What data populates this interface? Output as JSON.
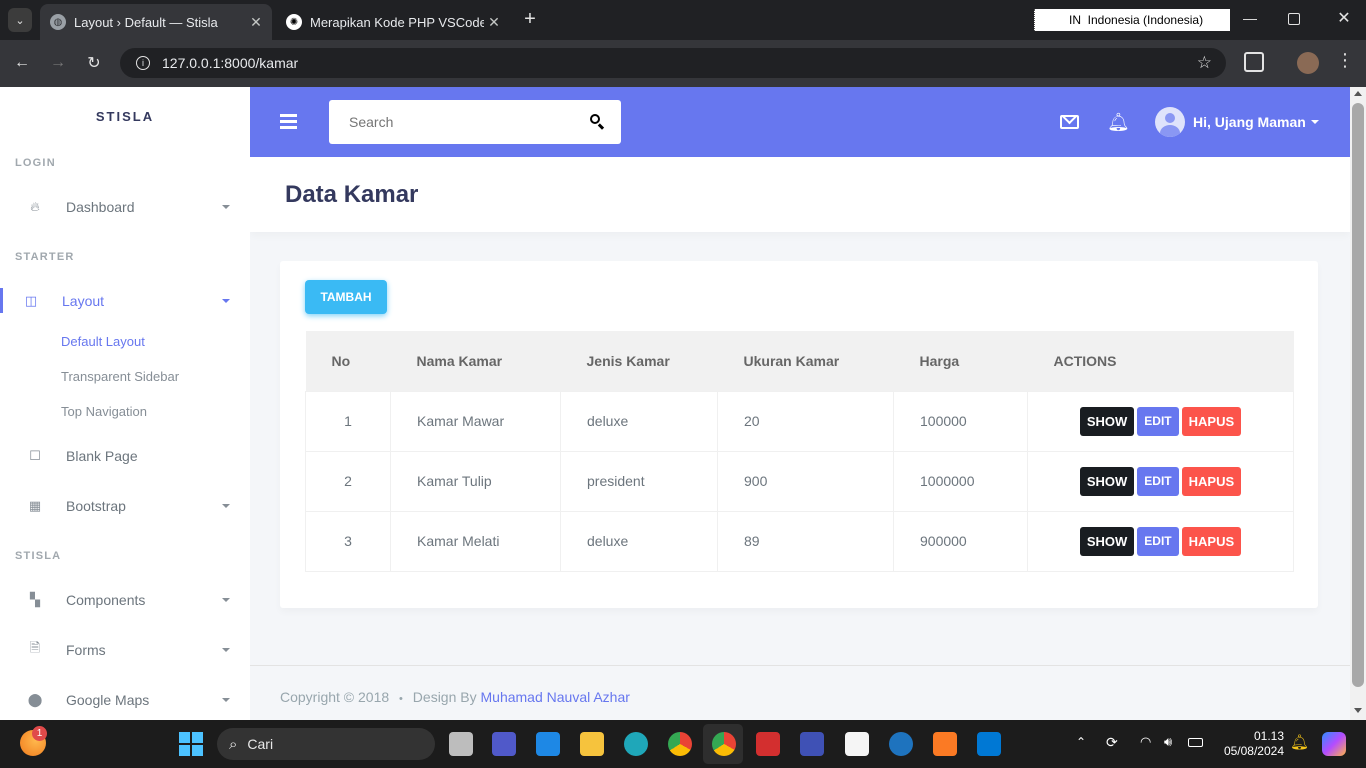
{
  "browser": {
    "tabs": [
      {
        "title": "Layout › Default — Stisla",
        "active": true
      },
      {
        "title": "Merapikan Kode PHP VSCode",
        "active": false
      }
    ],
    "language_indicator": "IN  Indonesia (Indonesia)",
    "url": "127.0.0.1:8000/kamar"
  },
  "sidebar": {
    "brand": "STISLA",
    "headers": {
      "login": "LOGIN",
      "starter": "STARTER",
      "stisla": "STISLA"
    },
    "items": {
      "dashboard": "Dashboard",
      "layout": "Layout",
      "default_layout": "Default Layout",
      "transparent_sidebar": "Transparent Sidebar",
      "top_navigation": "Top Navigation",
      "blank_page": "Blank Page",
      "bootstrap": "Bootstrap",
      "components": "Components",
      "forms": "Forms",
      "google_maps": "Google Maps"
    }
  },
  "navbar": {
    "search_placeholder": "Search",
    "user_greeting": "Hi, Ujang Maman"
  },
  "page": {
    "title": "Data Kamar",
    "add_button": "TAMBAH"
  },
  "table": {
    "headers": [
      "No",
      "Nama Kamar",
      "Jenis Kamar",
      "Ukuran Kamar",
      "Harga",
      "ACTIONS"
    ],
    "rows": [
      [
        "1",
        "Kamar Mawar",
        "deluxe",
        "20",
        "100000"
      ],
      [
        "2",
        "Kamar Tulip",
        "president",
        "900",
        "1000000"
      ],
      [
        "3",
        "Kamar Melati",
        "deluxe",
        "89",
        "900000"
      ]
    ],
    "actions": {
      "show": "SHOW",
      "edit": "EDIT",
      "delete": "HAPUS"
    }
  },
  "footer": {
    "copyright": "Copyright © 2018",
    "separator": "•",
    "design_by": "Design By",
    "author": "Muhamad Nauval Azhar"
  },
  "taskbar": {
    "notification_count": "1",
    "search_label": "Cari",
    "time": "01.13",
    "date": "05/08/2024"
  },
  "colors": {
    "primary": "#6777ef",
    "info": "#3abaf4",
    "danger": "#fc544b",
    "dark": "#191d21"
  }
}
